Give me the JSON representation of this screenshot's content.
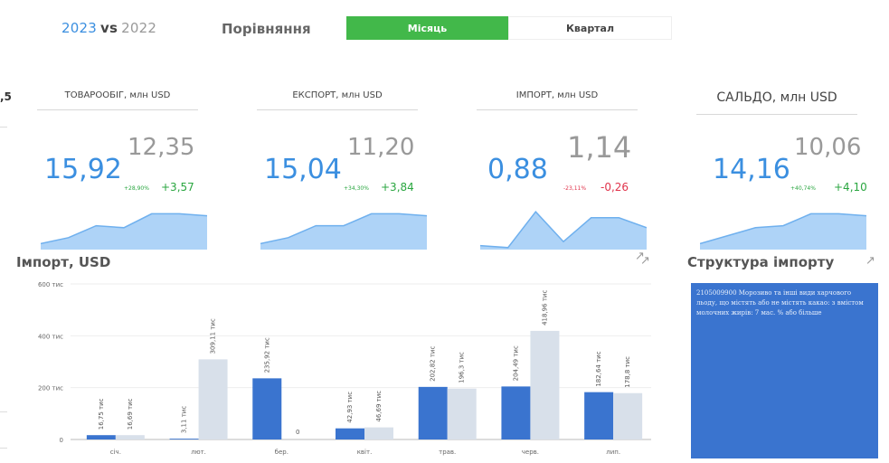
{
  "header": {
    "year_current": "2023",
    "vs": "vs",
    "year_previous": "2022",
    "compare_label": "Порівняння",
    "toggle_month": "Місяць",
    "toggle_quarter": "Квартал"
  },
  "edge_fragment": ",5",
  "cards": [
    {
      "title": "ТОВАРООБІГ, млн USD",
      "current": "15,92",
      "previous": "12,35",
      "pct": "+28,90%",
      "delta": "+3,57",
      "trend": "up",
      "spark": [
        0.15,
        0.3,
        0.6,
        0.55,
        0.9,
        0.9,
        0.85
      ]
    },
    {
      "title": "ЕКСПОРТ, млн USD",
      "current": "15,04",
      "previous": "11,20",
      "pct": "+34,30%",
      "delta": "+3,84",
      "trend": "up",
      "spark": [
        0.15,
        0.3,
        0.6,
        0.6,
        0.9,
        0.9,
        0.85
      ]
    },
    {
      "title": "ІМПОРТ, млн USD",
      "current": "0,88",
      "previous": "1,14",
      "pct": "-23,11%",
      "delta": "-0,26",
      "trend": "down",
      "spark": [
        0.1,
        0.05,
        0.95,
        0.2,
        0.8,
        0.8,
        0.55
      ]
    },
    {
      "title": "САЛЬДО, млн USD",
      "current": "14,16",
      "previous": "10,06",
      "pct": "+40,74%",
      "delta": "+4,10",
      "trend": "up",
      "spark": [
        0.15,
        0.35,
        0.55,
        0.6,
        0.9,
        0.9,
        0.85
      ]
    }
  ],
  "import_chart": {
    "title": "Імпорт, USD"
  },
  "structure": {
    "title": "Структура імпорту",
    "item_text": "2105009900 Морозиво та інші види харчового льоду, що містять або не містять какао: з вмістом молочних жирів: 7 мас. % або більше"
  },
  "colors": {
    "accent": "#3b8fe0",
    "toggle_active": "#42b84a",
    "bar_2023": "#3a74cf",
    "bar_2022": "#d8e0ea",
    "up": "#2aa640",
    "down": "#e0334b"
  },
  "chart_data": {
    "type": "bar",
    "categories": [
      "січ.",
      "лют.",
      "бер.",
      "квіт.",
      "трав.",
      "черв.",
      "лип."
    ],
    "series": [
      {
        "name": "2023",
        "values": [
          16.75,
          3.11,
          235.92,
          42.93,
          202.82,
          204.49,
          182.64
        ],
        "labels": [
          "16,75 тис",
          "3,11 тис",
          "235,92 тис",
          "42,93 тис",
          "202,82 тис",
          "204,49 тис",
          "182,64 тис"
        ]
      },
      {
        "name": "2022",
        "values": [
          16.69,
          309.11,
          0,
          46.69,
          196.3,
          418.96,
          178.8
        ],
        "labels": [
          "16,69 тис",
          "309,11 тис",
          "0",
          "46,69 тис",
          "196,3 тис",
          "418,96 тис",
          "178,8 тис"
        ]
      }
    ],
    "yticks": [
      "0",
      "200 тис",
      "400 тис",
      "600 тис"
    ],
    "ylim": [
      0,
      600
    ]
  }
}
